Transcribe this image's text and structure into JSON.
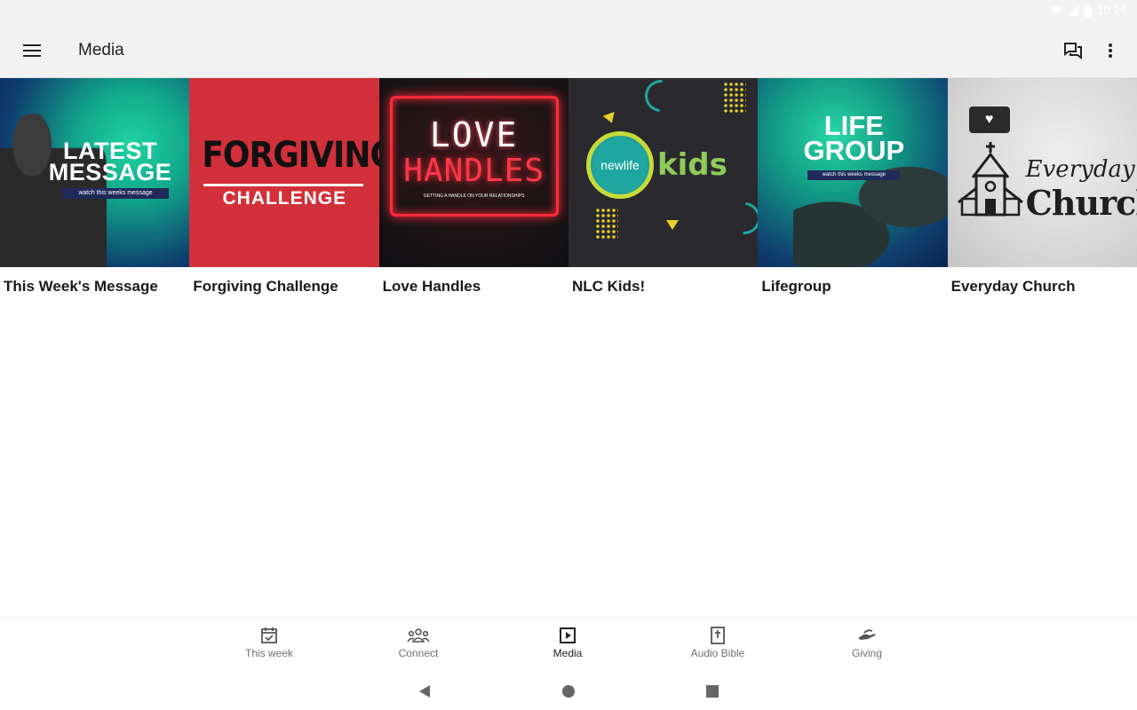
{
  "status_bar": {
    "time": "10:26"
  },
  "app_bar": {
    "title": "Media",
    "menu_icon": "hamburger-menu-icon",
    "chat_icon": "chat-bubbles-icon",
    "more_icon": "more-vert-icon"
  },
  "media_items": [
    {
      "label": "This Week's Message",
      "thumb": {
        "line1": "LATEST",
        "line2": "MESSAGE",
        "tag": "watch this weeks message"
      }
    },
    {
      "label": "Forgiving Challenge",
      "thumb": {
        "line1": "FORGIVING",
        "line2": "CHALLENGE"
      }
    },
    {
      "label": "Love Handles",
      "thumb": {
        "line1": "LOVE",
        "line2": "HANDLES",
        "tag": "GETTING A HANDLE ON YOUR RELATIONSHIPS"
      }
    },
    {
      "label": "NLC Kids!",
      "thumb": {
        "line1": "newlife",
        "line2": "kids"
      }
    },
    {
      "label": "Lifegroup",
      "thumb": {
        "line1": "LIFE",
        "line2": "GROUP",
        "tag": "watch this weeks message"
      }
    },
    {
      "label": "Everyday Church",
      "thumb": {
        "line1": "Everyday",
        "line2": "Church"
      }
    }
  ],
  "bottom_nav": [
    {
      "label": "This week",
      "icon": "calendar-check-icon"
    },
    {
      "label": "Connect",
      "icon": "group-icon"
    },
    {
      "label": "Media",
      "icon": "play-box-icon",
      "active": true
    },
    {
      "label": "Audio Bible",
      "icon": "bible-icon"
    },
    {
      "label": "Giving",
      "icon": "giving-hand-icon"
    }
  ],
  "colors": {
    "appbar_bg": "#f2f2f2",
    "active_nav": "#222222",
    "inactive_nav": "#6f6f6f"
  }
}
